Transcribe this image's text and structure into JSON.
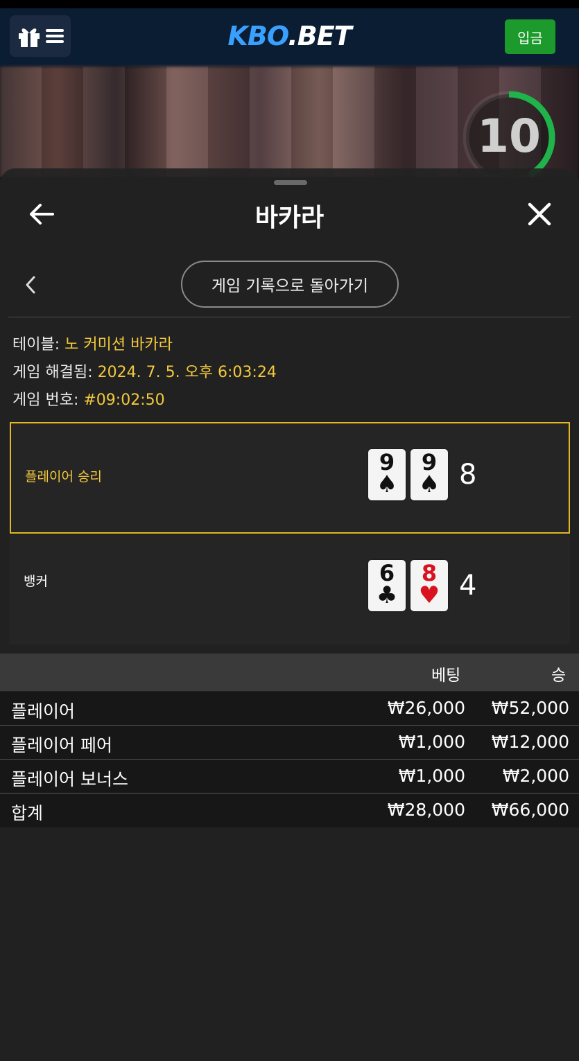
{
  "app": {
    "logo_k": "KBO",
    "logo_b": ".BET",
    "deposit_label": "입금",
    "timer_value": "10",
    "timer_progress": 0.42
  },
  "sheet": {
    "title": "바카라",
    "back_to_history": "게임 기록으로 돌아가기"
  },
  "info": {
    "table_label": "테이블: ",
    "table_value": "노 커미션 바카라",
    "resolved_label": "게임 해결됨: ",
    "resolved_value": "2024. 7. 5. 오후 6:03:24",
    "game_no_label": "게임 번호: ",
    "game_no_value": "#09:02:50"
  },
  "results": {
    "player": {
      "label": "플레이어 승리",
      "cards": [
        {
          "rank": "9",
          "suit": "♠"
        },
        {
          "rank": "9",
          "suit": "♠"
        }
      ],
      "score": "8"
    },
    "banker": {
      "label": "뱅커",
      "cards": [
        {
          "rank": "6",
          "suit": "♣"
        },
        {
          "rank": "8",
          "suit": "♥"
        }
      ],
      "score": "4"
    }
  },
  "bets_table": {
    "headers": {
      "bet": "베팅",
      "win": "승"
    },
    "rows": [
      {
        "name": "플레이어",
        "bet": "₩26,000",
        "win": "₩52,000"
      },
      {
        "name": "플레이어 페어",
        "bet": "₩1,000",
        "win": "₩12,000"
      },
      {
        "name": "플레이어 보너스",
        "bet": "₩1,000",
        "win": "₩2,000"
      },
      {
        "name": "합계",
        "bet": "₩28,000",
        "win": "₩66,000"
      }
    ]
  },
  "colors": {
    "accent_gold": "#e3b821",
    "deposit_green": "#1d9a2c",
    "logo_blue": "#3aa0ff",
    "timer_green": "#1fb34a"
  }
}
